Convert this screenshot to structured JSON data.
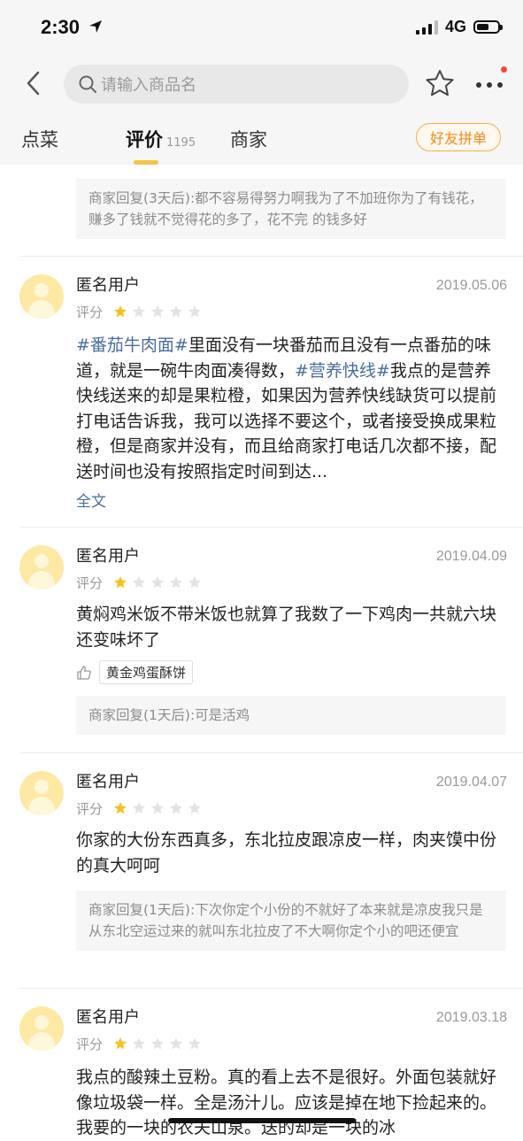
{
  "status_bar": {
    "time": "2:30",
    "network": "4G",
    "battery_level": 0.6
  },
  "nav": {
    "search_placeholder": "请输入商品名"
  },
  "tabs": {
    "order_label": "点菜",
    "review_label": "评价",
    "review_count": "1195",
    "merchant_label": "商家",
    "group_button": "好友拼单"
  },
  "accent_colors": {
    "tab_underline": "#f5c24a",
    "group_button": "#f08a1c",
    "link": "#4a6c9e",
    "star_on": "#f5c024",
    "star_off": "#e3e3e3"
  },
  "first_reply": "商家回复(3天后):都不容易得努力啊我为了不加班你为了有钱花，赚多了钱就不觉得花的多了，花不完 的钱多好",
  "reviews": [
    {
      "user": "匿名用户",
      "date": "2019.05.06",
      "rating_label": "评分",
      "rating": 1,
      "tag1": "#番茄牛肉面#",
      "text1": "里面没有一块番茄而且没有一点番茄的味道，就是一碗牛肉面凑得数，",
      "tag2": "#营养快线#",
      "text2": "我点的是营养快线送来的却是果粒橙，如果因为营养快线缺货可以提前打电话告诉我，我可以选择不要这个，或者接受换成果粒橙，但是商家并没有，而且给商家打电话几次都不接，配送时间也没有按照指定时间到达...",
      "fulltext_label": "全文"
    },
    {
      "user": "匿名用户",
      "date": "2019.04.09",
      "rating_label": "评分",
      "rating": 1,
      "text": "黄焖鸡米饭不带米饭也就算了我数了一下鸡肉一共就六块还变味坏了",
      "liked_dish": "黄金鸡蛋酥饼",
      "reply": "商家回复(1天后):可是活鸡"
    },
    {
      "user": "匿名用户",
      "date": "2019.04.07",
      "rating_label": "评分",
      "rating": 1,
      "text": "你家的大份东西真多，东北拉皮跟凉皮一样，肉夹馍中份的真大呵呵",
      "reply": "商家回复(1天后):下次你定个小份的不就好了本来就是凉皮我只是从东北空运过来的就叫东北拉皮了不大啊你定个小的吧还便宜"
    },
    {
      "user": "匿名用户",
      "date": "2019.03.18",
      "rating_label": "评分",
      "rating": 1,
      "text": "我点的酸辣土豆粉。真的看上去不是很好。外面包装就好像垃圾袋一样。全是汤汁儿。应该是掉在地下捡起来的。我要的一块的农夫山泉。送的却是一块的冰"
    }
  ]
}
